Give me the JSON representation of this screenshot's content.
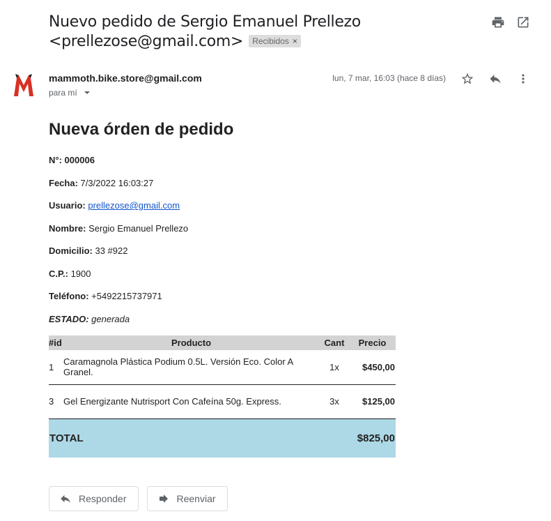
{
  "email": {
    "subject": "Nuevo pedido de Sergio Emanuel Prellezo <prellezose@gmail.com>",
    "label": "Recibidos",
    "sender": "mammoth.bike.store@gmail.com",
    "recipient": "para mí",
    "date": "lun, 7 mar, 16:03 (hace 8 días)"
  },
  "body": {
    "heading": "Nueva órden de pedido",
    "fields": {
      "numero_label": "N°:",
      "numero_value": "000006",
      "fecha_label": "Fecha:",
      "fecha_value": "7/3/2022 16:03:27",
      "usuario_label": "Usuario:",
      "usuario_value": "prellezose@gmail.com",
      "nombre_label": "Nombre:",
      "nombre_value": "Sergio Emanuel Prellezo",
      "domicilio_label": "Domicilio:",
      "domicilio_value": "33 #922",
      "cp_label": "C.P.:",
      "cp_value": "1900",
      "telefono_label": "Teléfono:",
      "telefono_value": "+5492215737971",
      "estado_label": "ESTADO:",
      "estado_value": "generada"
    },
    "table": {
      "headers": {
        "id": "#id",
        "producto": "Producto",
        "cant": "Cant",
        "precio": "Precio"
      },
      "rows": [
        {
          "id": "1",
          "producto": "Caramagnola Plástica Podium 0.5L. Versión Eco. Color A Granel.",
          "cant": "1x",
          "precio": "$450,00"
        },
        {
          "id": "3",
          "producto": "Gel Energizante Nutrisport Con Cafeína 50g. Express.",
          "cant": "3x",
          "precio": "$125,00"
        }
      ],
      "total_label": "TOTAL",
      "total_value": "$825,00"
    }
  },
  "actions": {
    "reply": "Responder",
    "forward": "Reenviar"
  },
  "icons": {
    "print": "print-icon",
    "open_new_window": "open-in-new-icon",
    "star": "star-icon",
    "reply": "reply-icon",
    "more": "more-vert-icon",
    "forward": "forward-icon"
  },
  "colors": {
    "table_header": "#d3d3d3",
    "total_row": "#add8e6",
    "link": "#1155cc",
    "avatar_red": "#d93025"
  }
}
